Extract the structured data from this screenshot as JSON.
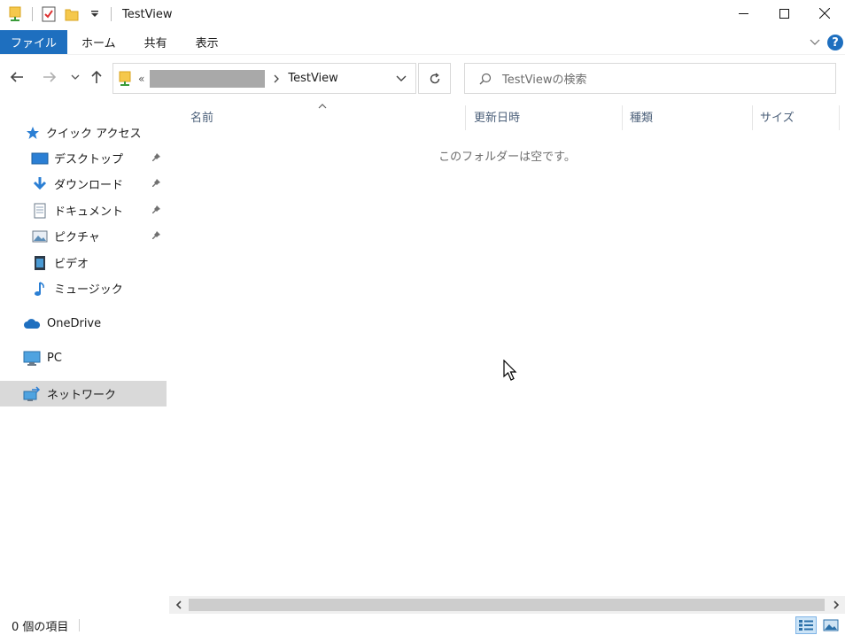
{
  "window": {
    "title": "TestView",
    "minimize_icon": "minimize-icon",
    "maximize_icon": "maximize-icon",
    "close_icon": "close-icon"
  },
  "ribbon": {
    "tabs": [
      "ファイル",
      "ホーム",
      "共有",
      "表示"
    ],
    "accent": "#1e6fbf"
  },
  "address": {
    "prefix": "«",
    "current": "TestView",
    "search_placeholder": "TestViewの検索"
  },
  "nav": {
    "items": [
      {
        "label": "クイック アクセス",
        "icon": "star-icon"
      },
      {
        "label": "デスクトップ",
        "icon": "desktop-icon",
        "pinned": true
      },
      {
        "label": "ダウンロード",
        "icon": "download-icon",
        "pinned": true
      },
      {
        "label": "ドキュメント",
        "icon": "document-icon",
        "pinned": true
      },
      {
        "label": "ピクチャ",
        "icon": "picture-icon",
        "pinned": true
      },
      {
        "label": "ビデオ",
        "icon": "video-icon"
      },
      {
        "label": "ミュージック",
        "icon": "music-icon"
      },
      {
        "label": "OneDrive",
        "icon": "cloud-icon"
      },
      {
        "label": "PC",
        "icon": "computer-icon"
      },
      {
        "label": "ネットワーク",
        "icon": "network-icon",
        "selected": true
      }
    ]
  },
  "columns": [
    "名前",
    "更新日時",
    "種類",
    "サイズ"
  ],
  "content": {
    "empty_message": "このフォルダーは空です。"
  },
  "status": {
    "item_count": "0 個の項目"
  }
}
